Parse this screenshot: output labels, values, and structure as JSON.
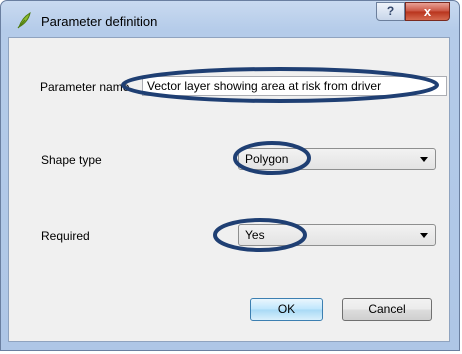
{
  "dialog": {
    "title": "Parameter definition",
    "help_label": "?",
    "close_label": "x"
  },
  "form": {
    "parameter_name_label": "Parameter name",
    "parameter_name_value": "Vector layer showing area at risk from driver",
    "shape_type_label": "Shape type",
    "shape_type_value": "Polygon",
    "required_label": "Required",
    "required_value": "Yes"
  },
  "buttons": {
    "ok_label": "OK",
    "cancel_label": "Cancel"
  },
  "annotation_color": "#1f3f73"
}
